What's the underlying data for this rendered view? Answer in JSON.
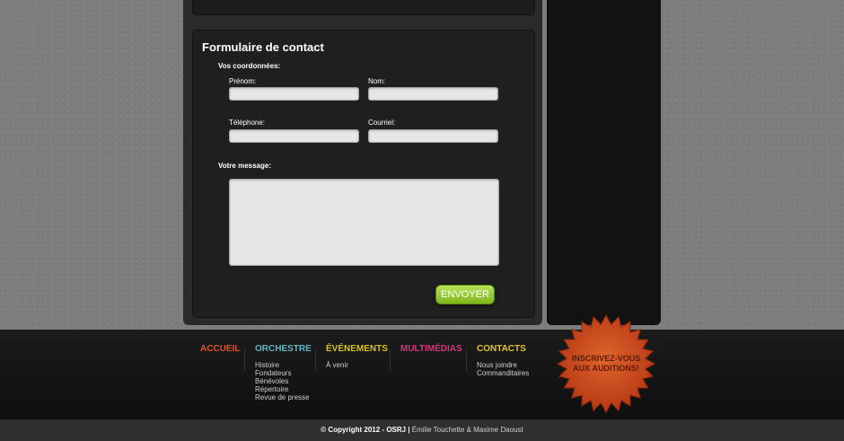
{
  "form": {
    "title": "Formulaire de contact",
    "section_coordinates": "Vos coordonnées:",
    "prenom_label": "Prénom:",
    "nom_label": "Nom:",
    "telephone_label": "Téléphone:",
    "courriel_label": "Courriel:",
    "message_label": "Votre message:",
    "prenom_value": "",
    "nom_value": "",
    "telephone_value": "",
    "courriel_value": "",
    "message_value": "",
    "send_label": "ENVOYER"
  },
  "footer_menu": [
    {
      "label": "ACCUEIL",
      "color": "#e0502c",
      "items": []
    },
    {
      "label": "ORCHESTRE",
      "color": "#5fb7c9",
      "items": [
        "Histoire",
        "Fondateurs",
        "Bénévoles",
        "Répertoire",
        "Revue de presse"
      ]
    },
    {
      "label": "ÉVÉNEMENTS",
      "color": "#d8c22b",
      "items": [
        "À venir"
      ]
    },
    {
      "label": "MULTIMÉDIAS",
      "color": "#d2347a",
      "items": []
    },
    {
      "label": "CONTACTS",
      "color": "#e2c42e",
      "items": [
        "Nous joindre",
        "Commanditaires"
      ]
    }
  ],
  "badge": {
    "line1": "INSCRIVEZ-VOUS",
    "line2": "AUX AUDITIONS!",
    "color": "#c8401a"
  },
  "copyright": {
    "main": "© Copyright 2012 - OSRJ |",
    "authors": "Émilie Touchette & Maxime Daoust"
  }
}
